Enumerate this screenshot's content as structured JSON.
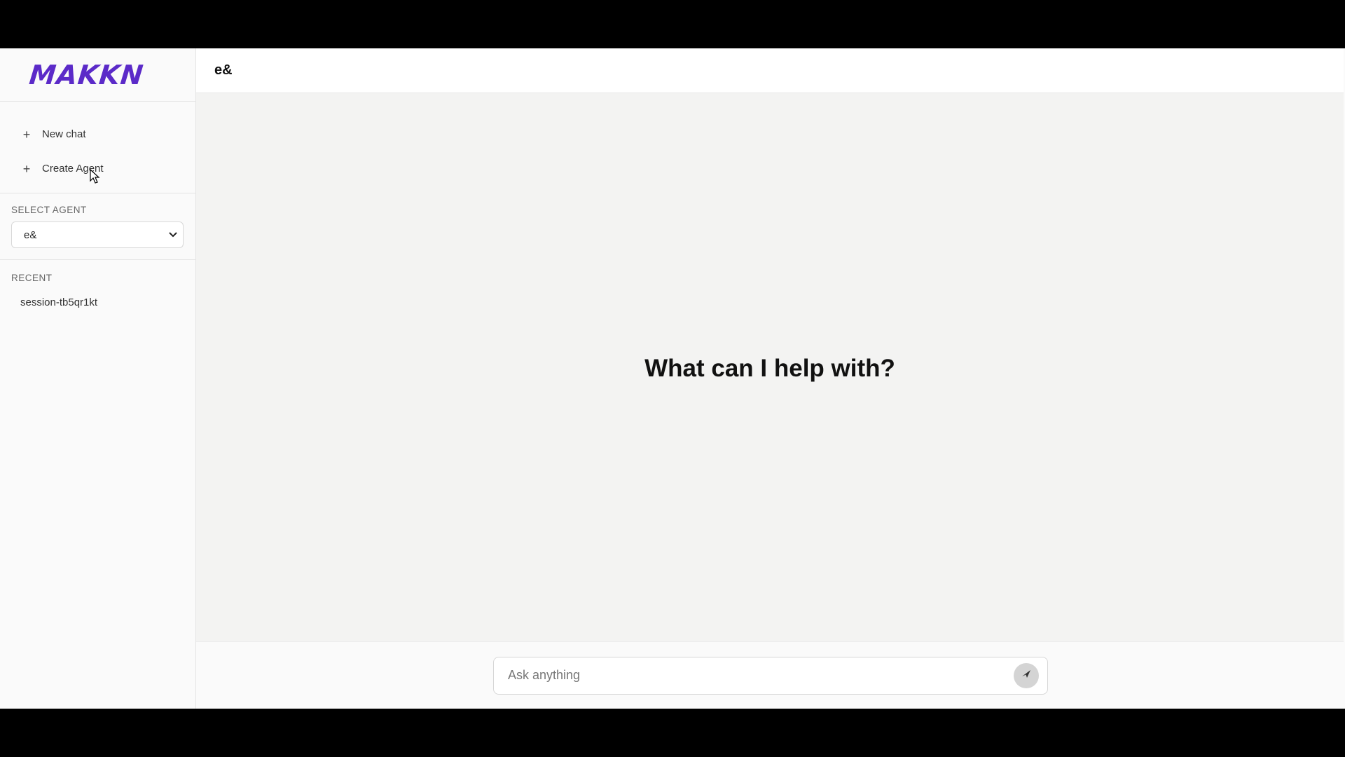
{
  "brand": {
    "logo_text": "MAKKN",
    "color": "#5b2ac8"
  },
  "sidebar": {
    "actions": [
      {
        "label": "New chat",
        "icon": "plus-icon"
      },
      {
        "label": "Create Agent",
        "icon": "plus-icon"
      }
    ],
    "select_agent": {
      "label": "SELECT AGENT",
      "value": "e&"
    },
    "recent": {
      "label": "RECENT",
      "items": [
        "session-tb5qr1kt"
      ]
    }
  },
  "header": {
    "title": "e&"
  },
  "main": {
    "headline": "What can I help with?"
  },
  "composer": {
    "placeholder": "Ask anything",
    "send_icon": "send-icon"
  }
}
